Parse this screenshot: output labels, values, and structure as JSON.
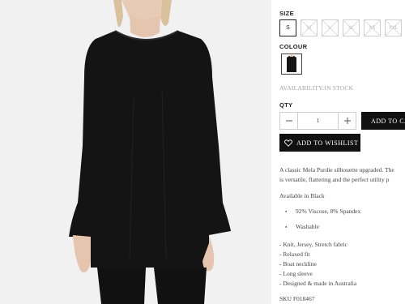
{
  "product": {
    "size_label": "SIZE",
    "sizes": [
      {
        "label": "S",
        "available": true,
        "selected": true
      },
      {
        "label": "M",
        "available": false,
        "selected": false
      },
      {
        "label": "L",
        "available": false,
        "selected": false
      },
      {
        "label": "XL",
        "available": false,
        "selected": false
      },
      {
        "label": "XS",
        "available": false,
        "selected": false
      },
      {
        "label": "XXL",
        "available": false,
        "selected": false
      }
    ],
    "colour_label": "COLOUR",
    "availability": "AVAILABILITY:IN STOCK",
    "qty_label": "QTY",
    "qty_value": "1",
    "add_to_cart": "ADD TO CART",
    "add_to_wishlist": "ADD TO WISHLIST",
    "description_lines": [
      "A classic Mela Purdie silhouette upgraded. The",
      "is versatile, flattering and the perfect utility p"
    ],
    "available_in": "Available in Black",
    "composition": [
      "92% Viscose, 8% Spandex",
      "Washable"
    ],
    "features": [
      "- Knit, Jersey, Stretch fabric",
      "- Relaxed fit",
      "- Boat neckline",
      "- Long sleeve",
      "- Designed & made in Australia"
    ],
    "sku": "SKU F018467"
  },
  "colors": {
    "accent": "#111111",
    "border": "#cfcfcf",
    "muted": "#a3a3a3",
    "garment": "#141414"
  },
  "icons": [
    "minus-icon",
    "plus-icon",
    "heart-icon"
  ]
}
